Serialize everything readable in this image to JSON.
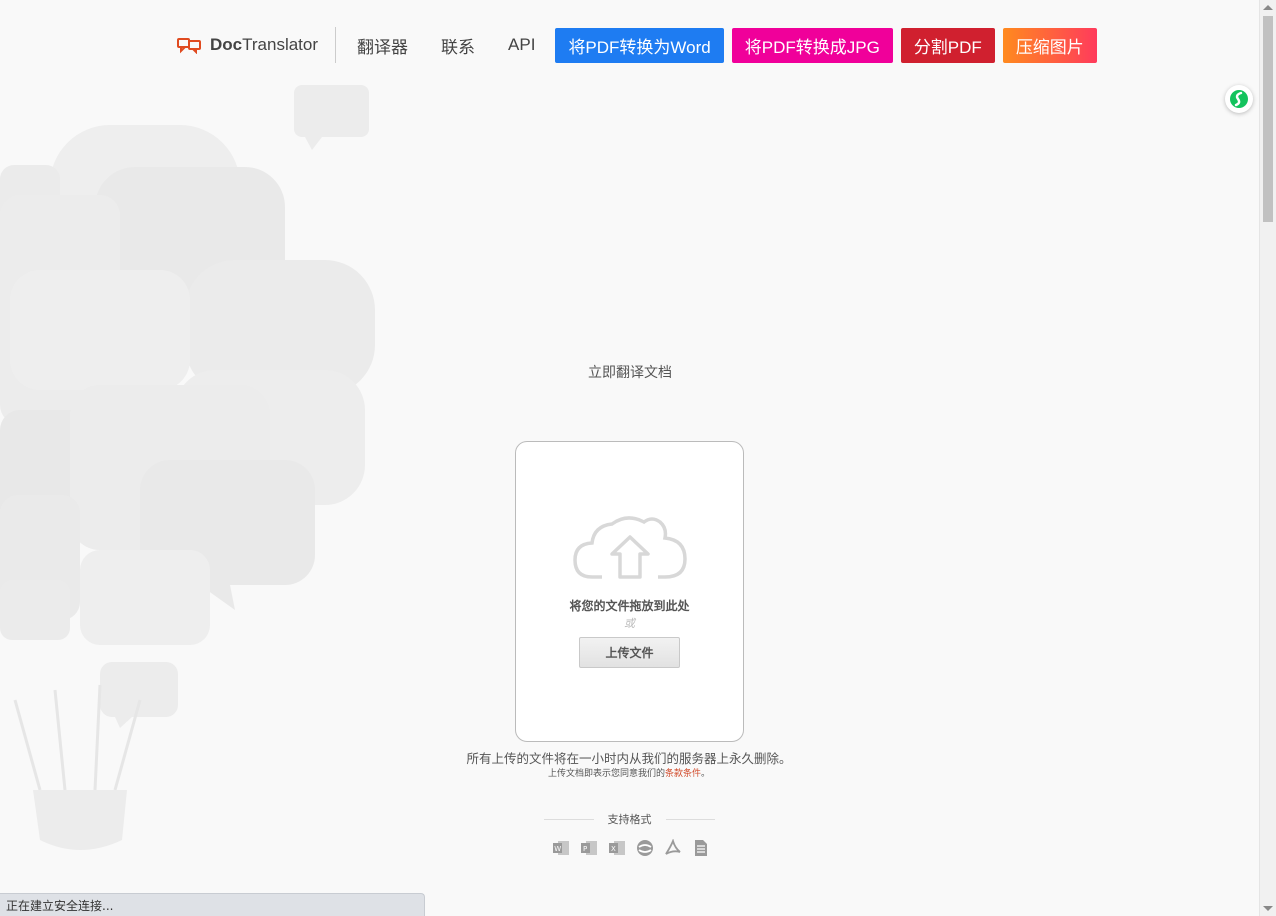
{
  "header": {
    "logo_bold": "Doc",
    "logo_rest": "Translator",
    "nav": [
      "翻译器",
      "联系",
      "API"
    ],
    "cta": [
      {
        "label": "将PDF转换为Word",
        "color": "#1e7cf2"
      },
      {
        "label": "将PDF转换成JPG",
        "color": "#f0009a"
      },
      {
        "label": "分割PDF",
        "color": "#d0202f"
      },
      {
        "label": "压缩图片",
        "color": "#ff6a3d"
      }
    ]
  },
  "main": {
    "heading": "立即翻译文档",
    "drop_text": "将您的文件拖放到此处",
    "or_text": "或",
    "upload_label": "上传文件",
    "note": "所有上传的文件将在一小时内从我们的服务器上永久删除。",
    "subnote_prefix": "上传文档即表示您同意我们的",
    "subnote_link": "条款条件",
    "subnote_suffix": "。",
    "formats_title": "支持格式",
    "formats": [
      "word-icon",
      "powerpoint-icon",
      "excel-icon",
      "opendocument-icon",
      "pdf-icon",
      "text-file-icon"
    ]
  },
  "status_bar": {
    "text": "正在建立安全连接..."
  }
}
